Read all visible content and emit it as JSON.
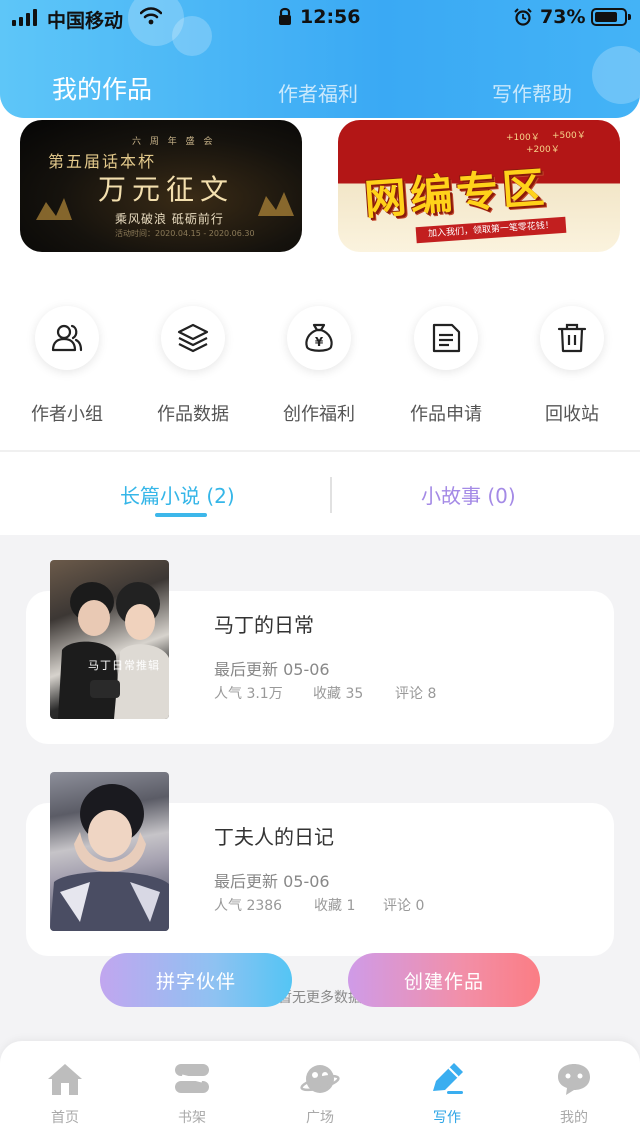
{
  "status_bar": {
    "carrier": "中国移动",
    "time": "12:56",
    "battery": "73%"
  },
  "header": {
    "tabs": [
      {
        "label": "我的作品",
        "active": true
      },
      {
        "label": "作者福利",
        "active": false
      },
      {
        "label": "写作帮助",
        "active": false
      }
    ]
  },
  "banners": [
    {
      "name": "contest",
      "small": "六 周 年 盛 会",
      "line1": "第五届话本杯",
      "title": "万元征文",
      "slogan": "乘风破浪 砥砺前行",
      "date": "活动时间：2020.04.15 - 2020.06.30"
    },
    {
      "name": "network-zone",
      "title": "网编专区",
      "strip": "加入我们，领取第一笔零花钱！",
      "money": [
        "+100￥",
        "+500￥",
        "+200￥"
      ]
    }
  ],
  "shortcuts": [
    {
      "label": "作者小组",
      "icon": "users-icon"
    },
    {
      "label": "作品数据",
      "icon": "layers-icon"
    },
    {
      "label": "创作福利",
      "icon": "money-bag-icon"
    },
    {
      "label": "作品申请",
      "icon": "document-icon"
    },
    {
      "label": "回收站",
      "icon": "trash-icon"
    }
  ],
  "work_tabs": [
    {
      "label": "长篇小说 (2)",
      "active": true
    },
    {
      "label": "小故事 (0)",
      "active": false
    }
  ],
  "books": [
    {
      "title": "马丁的日常",
      "updated": "最后更新 05-06",
      "popularity": "人气 3.1万",
      "favorites": "收藏 35",
      "comments": "评论 8",
      "cover_caption": "马丁日常推辑"
    },
    {
      "title": "丁夫人的日记",
      "updated": "最后更新 05-06",
      "popularity": "人气 2386",
      "favorites": "收藏 1",
      "comments": "评论 0",
      "cover_caption": ""
    }
  ],
  "no_more": "暂无更多数据",
  "buttons": {
    "partner": "拼字伙伴",
    "create": "创建作品"
  },
  "tabbar": [
    {
      "label": "首页",
      "icon": "home-icon",
      "active": false
    },
    {
      "label": "书架",
      "icon": "bookshelf-icon",
      "active": false
    },
    {
      "label": "广场",
      "icon": "planet-icon",
      "active": false
    },
    {
      "label": "写作",
      "icon": "pen-icon",
      "active": true
    },
    {
      "label": "我的",
      "icon": "chat-face-icon",
      "active": false
    }
  ],
  "colors": {
    "header_gradient_start": "#5ec6f8",
    "header_gradient_end": "#3aa9f4",
    "tab_active": "#35b6e8",
    "tab_inactive": "#a48ae6",
    "tabbar_active": "#2da5e6"
  }
}
